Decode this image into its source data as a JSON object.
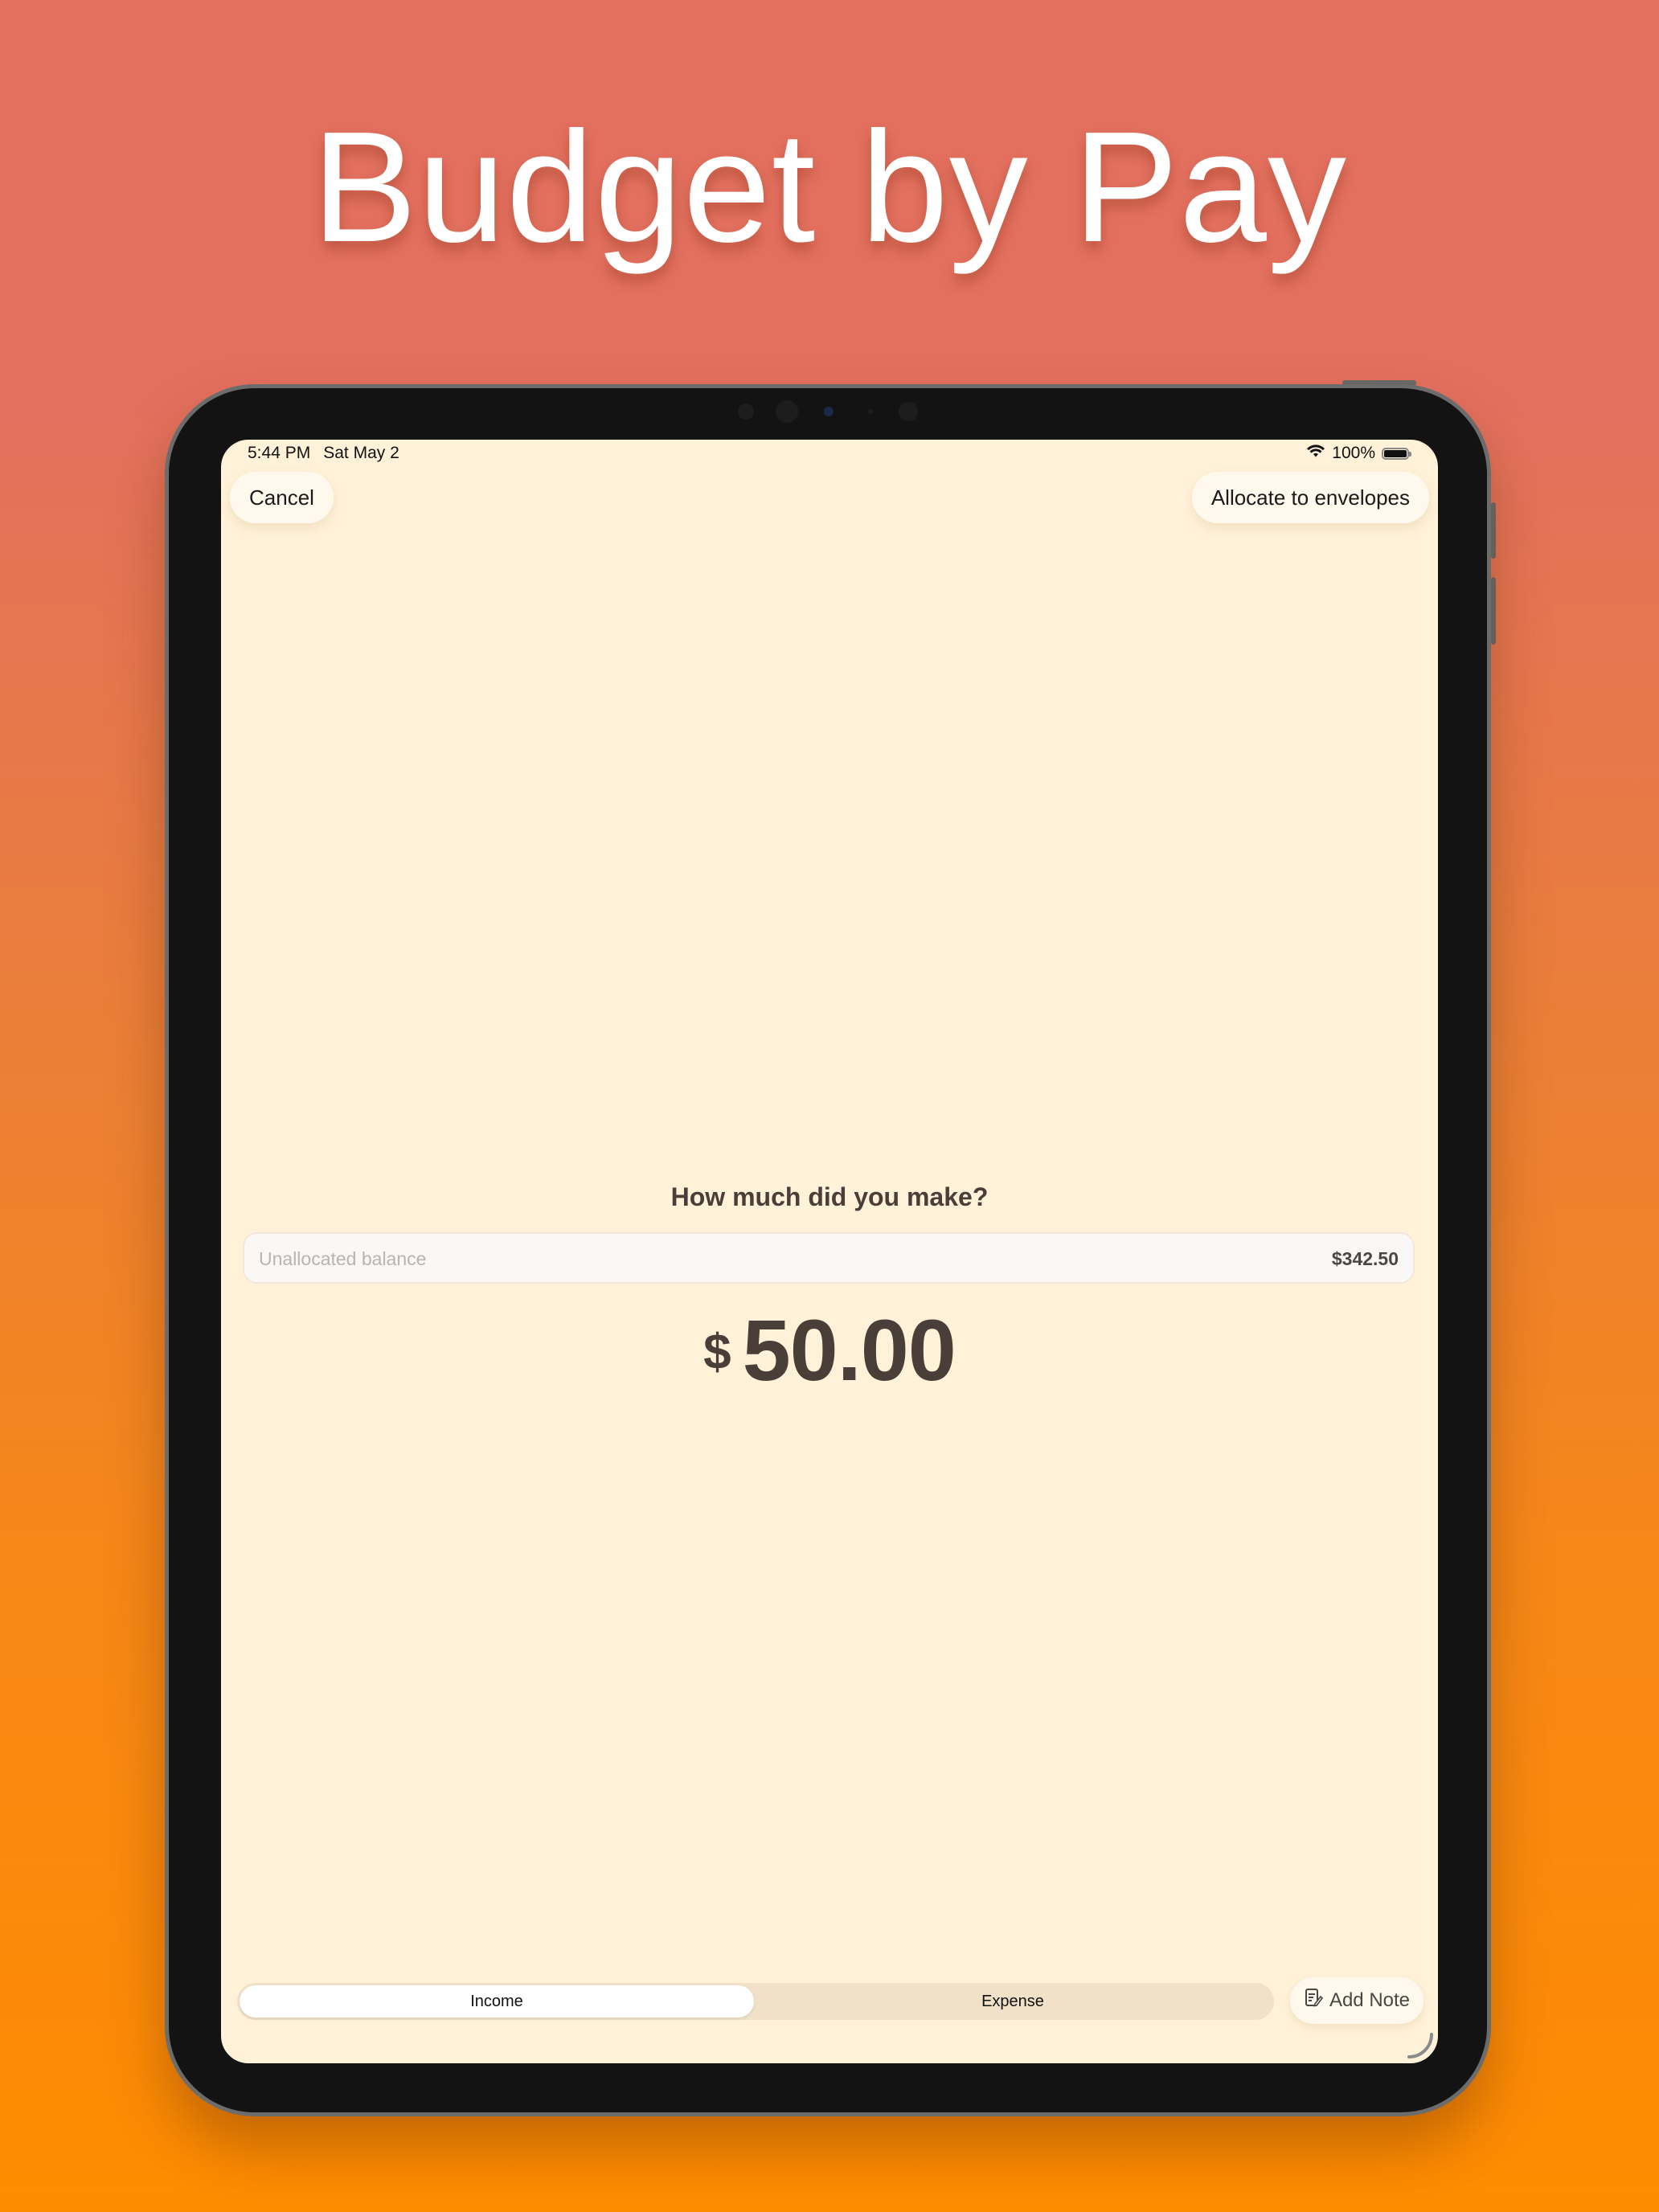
{
  "headline": "Budget by Pay",
  "status_bar": {
    "time": "5:44 PM",
    "date": "Sat May 2",
    "battery_percent": "100%"
  },
  "nav": {
    "cancel_label": "Cancel",
    "allocate_label": "Allocate to envelopes"
  },
  "prompt": "How much did you make?",
  "balance": {
    "label": "Unallocated balance",
    "value": "$342.50"
  },
  "amount": {
    "currency": "$",
    "value": "50.00"
  },
  "type_selector": {
    "options": [
      "Income",
      "Expense"
    ],
    "selected": "Income"
  },
  "add_note_label": "Add Note",
  "colors": {
    "screen_background": "#FFF2D9",
    "text_primary": "#4A3E38",
    "segment_track": "#F0E1C8"
  }
}
